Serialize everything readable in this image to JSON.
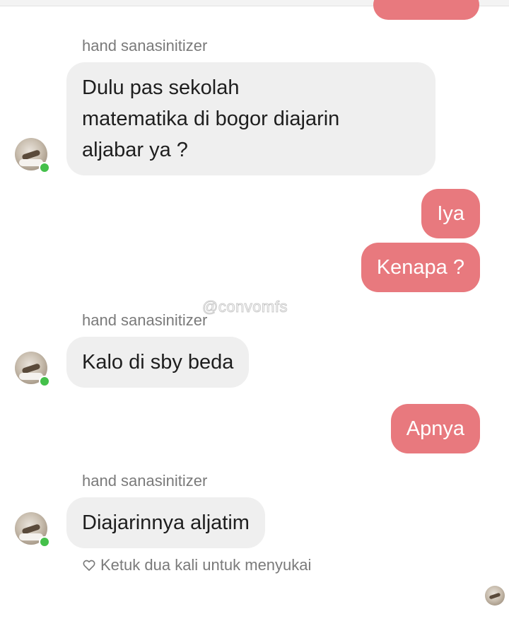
{
  "colors": {
    "outgoing_bubble": "#e8797e",
    "incoming_bubble": "#efefef",
    "online_indicator": "#44c04a"
  },
  "watermark": "@convomfs",
  "messages": [
    {
      "direction": "in",
      "sender": "hand sanasinitizer",
      "lines": [
        "Dulu pas sekolah",
        "matematika di bogor diajarin",
        "aljabar ya ?"
      ]
    },
    {
      "direction": "out",
      "text": "Iya"
    },
    {
      "direction": "out",
      "text": "Kenapa ?"
    },
    {
      "direction": "in",
      "sender": "hand sanasinitizer",
      "lines": [
        "Kalo di sby beda"
      ]
    },
    {
      "direction": "out",
      "text": "Apnya"
    },
    {
      "direction": "in",
      "sender": "hand sanasinitizer",
      "lines": [
        "Diajarinnya aljatim"
      ]
    }
  ],
  "like_hint": "Ketuk dua kali untuk menyukai",
  "icons": {
    "avatar": "user-avatar",
    "like": "heart-outline-icon",
    "seen": "seen-avatar"
  }
}
